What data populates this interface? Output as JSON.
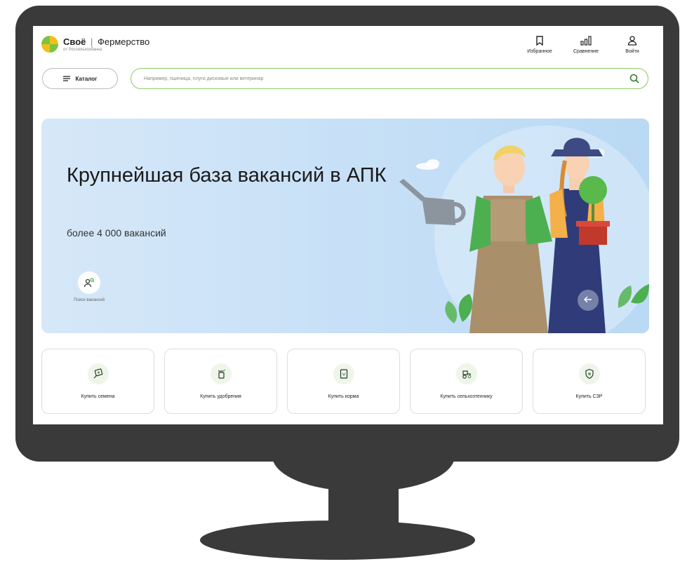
{
  "header": {
    "brand": "Своё",
    "separator": "|",
    "product": "Фермерство",
    "subtitle": "от Россельхозбанка",
    "actions": [
      {
        "label": "Избранное",
        "icon": "bookmark-icon"
      },
      {
        "label": "Сравнение",
        "icon": "compare-icon"
      },
      {
        "label": "Войти",
        "icon": "user-icon"
      }
    ]
  },
  "catalog": {
    "label": "Каталог",
    "icon": "menu-icon"
  },
  "search": {
    "placeholder": "Например, пшеница, плуги дисковые или ветеринар",
    "icon": "search-icon"
  },
  "banner": {
    "title": "Крупнейшая база вакансий в АПК",
    "subtitle": "более 4 000 вакансий",
    "vacancy_search_label": "Поиск вакансий",
    "vacancy_icon": "person-search-icon",
    "prev_icon": "arrow-left-icon"
  },
  "categories": [
    {
      "label": "Купить семена",
      "icon": "seeds-icon"
    },
    {
      "label": "Купить удобрения",
      "icon": "fertilizer-icon"
    },
    {
      "label": "Купить корма",
      "icon": "feed-icon"
    },
    {
      "label": "Купить сельхозтехнику",
      "icon": "tractor-icon"
    },
    {
      "label": "Купить СЗР",
      "icon": "shield-icon"
    }
  ],
  "colors": {
    "accent_green": "#8dc86a",
    "monitor": "#3a3a3a",
    "banner_bg": "#c9e1f7"
  }
}
